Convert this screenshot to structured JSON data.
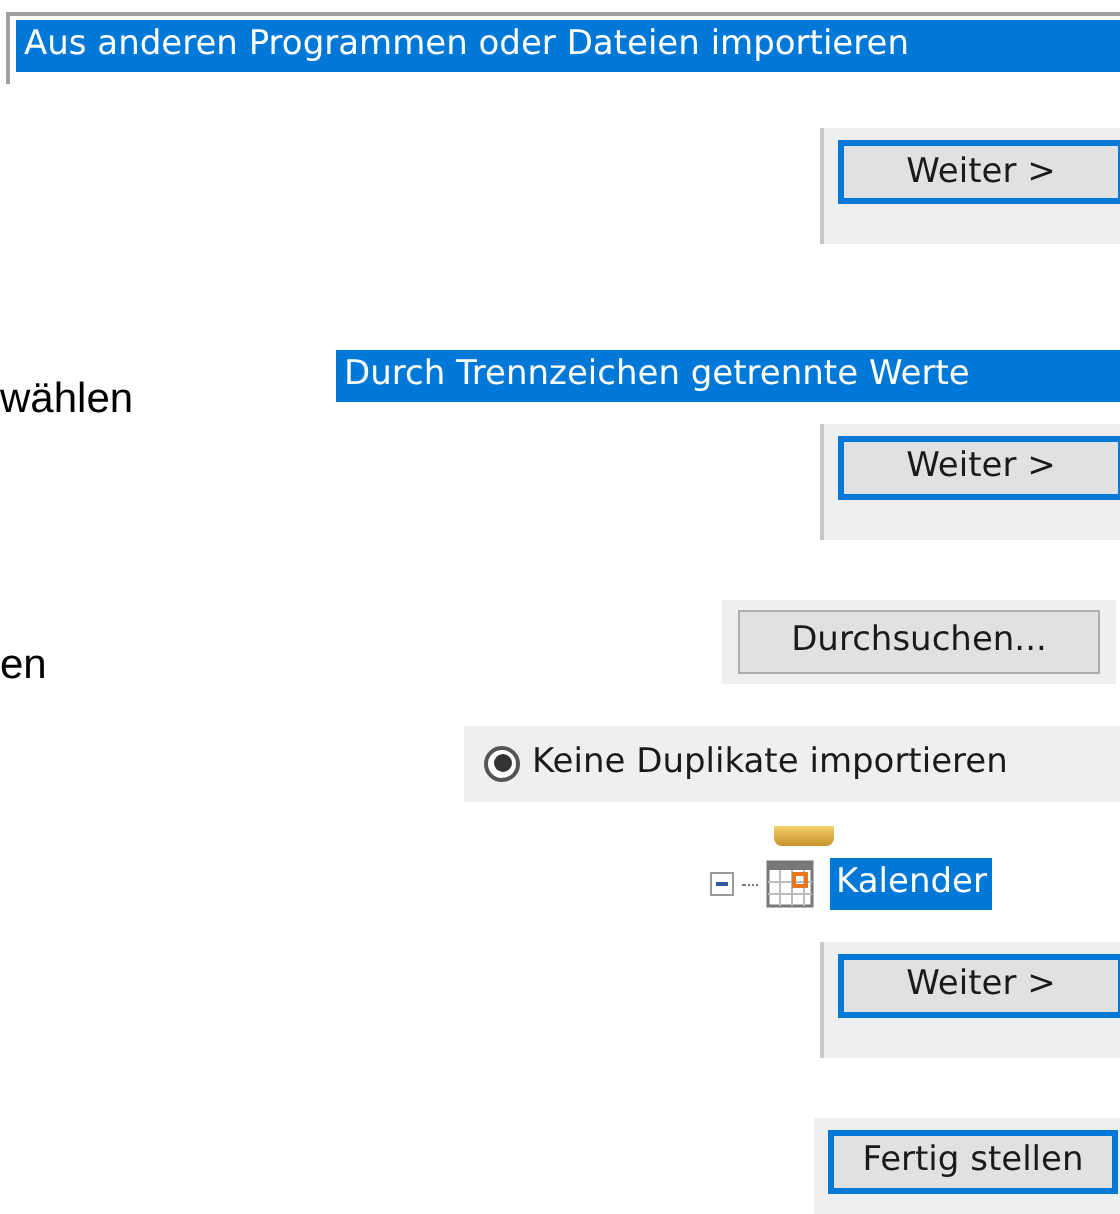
{
  "steps": [
    {
      "kind": "list",
      "item": {
        "label": "Aus anderen Programmen oder Dateien importieren",
        "selected": true
      }
    },
    {
      "kind": "button",
      "label": "Weiter >",
      "default": true
    },
    {
      "kind": "instruction_list",
      "instruction": "wählen",
      "item": {
        "label": "Durch Trennzeichen getrennte Werte",
        "selected": true
      }
    },
    {
      "kind": "button",
      "label": "Weiter >",
      "default": true
    },
    {
      "kind": "instruction_button",
      "instruction": "en",
      "label": "Durchsuchen...",
      "default": false
    },
    {
      "kind": "radio",
      "label": "Keine Duplikate importieren",
      "selected": true
    },
    {
      "kind": "tree",
      "item": {
        "label": "Kalender",
        "selected": true,
        "expanded": true
      }
    },
    {
      "kind": "button",
      "label": "Weiter >",
      "default": true
    },
    {
      "kind": "button_small",
      "label": "Fertig stellen",
      "default": true
    }
  ]
}
